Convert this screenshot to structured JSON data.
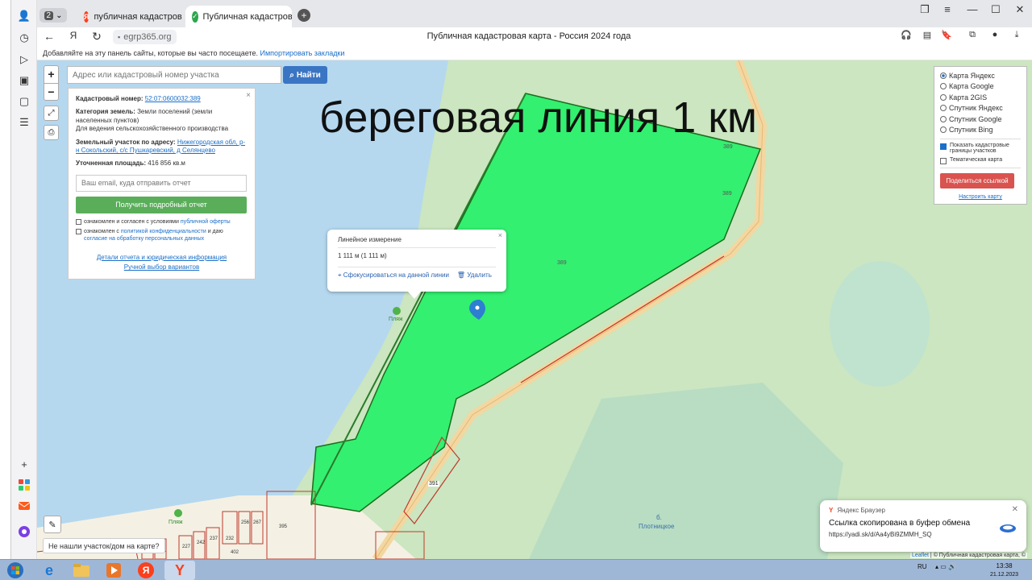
{
  "browser": {
    "tab_count": "2",
    "tabs": [
      {
        "label": "публичная кадастровая к"
      },
      {
        "label": "Публичная кадастровая"
      }
    ],
    "url": "egrp365.org",
    "page_title": "Публичная кадастровая карта - Россия 2024 года"
  },
  "bookmarks_bar": {
    "text": "Добавляйте на эту панель сайты, которые вы часто посещаете.",
    "import_link": "Импортировать закладки"
  },
  "map": {
    "zoom_in": "+",
    "zoom_out": "−",
    "search_placeholder": "Адрес или кадастровый номер участка",
    "search_button": "Найти",
    "overlay_title": "береговая линия 1 км",
    "labels": {
      "parcel_389_a": "389",
      "parcel_389_b": "389",
      "parcel_389_c": "389",
      "parcel_391": "391",
      "beach_1": "Пляж",
      "beach_2": "Пляж",
      "lake_1": "б.",
      "lake_2": "Плотницкое",
      "small_parcels": [
        "232",
        "256",
        "267",
        "237",
        "242",
        "227",
        "240",
        "401",
        "402",
        "395"
      ]
    }
  },
  "info_panel": {
    "cadastral_label": "Кадастровый номер:",
    "cadastral_value": "52:07:0600032:389",
    "category_label": "Категория земель:",
    "category_value": "Земли поселений (земли населенных пунктов)",
    "usage": "Для ведения сельскохозяйственного производства",
    "address_label": "Земельный участок по адресу:",
    "address_value": "Нижегородская обл, р-н Сокольский, с/с Пушкаревский, д Селянцево",
    "area_label": "Уточненная площадь:",
    "area_value": "416 856 кв.м",
    "email_placeholder": "Ваш email, куда отправить отчет",
    "report_button": "Получить подробный отчет",
    "agree1_text": "ознакомлен и согласен с условиями",
    "agree1_link": "публичной оферты",
    "agree2_text": "ознакомлен с",
    "agree2_link1": "политикой конфиденциальности",
    "agree2_mid": "и даю",
    "agree2_link2": "согласие на обработку персональных данных",
    "details_link": "Детали отчета и юридическая информация",
    "manual_link": "Ручной выбор вариантов"
  },
  "measure_popup": {
    "title": "Линейное измерение",
    "value": "1 111 м (1 111 м)",
    "focus": "Сфокусироваться на данной линии",
    "delete": "Удалить"
  },
  "layers_panel": {
    "options": [
      "Карта Яндекс",
      "Карта Google",
      "Карта 2GIS",
      "Спутник Яндекс",
      "Спутник Google",
      "Спутник Bing"
    ],
    "selected_index": 0,
    "show_borders": "Показать кадастровые границы участков",
    "thematic": "Тематическая карта",
    "share_button": "Поделиться ссылкой",
    "setup_link": "Настроить карту"
  },
  "not_found": "Не нашли участок/дом на карте?",
  "attribution": {
    "leaflet": "Leaflet",
    "rest": " | © Публичная кадастровая карта, ©"
  },
  "toast": {
    "app": "Яндекс Браузер",
    "title": "Ссылка скопирована в буфер обмена",
    "url": "https://yadi.sk/d/Aa4yBi9ZMMH_SQ"
  },
  "taskbar": {
    "lang": "RU",
    "time": "13:38",
    "date": "21.12.2023"
  },
  "colors": {
    "water": "#b5d8ef",
    "land": "#cbe6c0",
    "parcel": "#33f070",
    "parcel_border": "#1d6b1d",
    "search_button": "#3a75c4",
    "report_button": "#5aae5a",
    "share_button": "#d9534f"
  }
}
